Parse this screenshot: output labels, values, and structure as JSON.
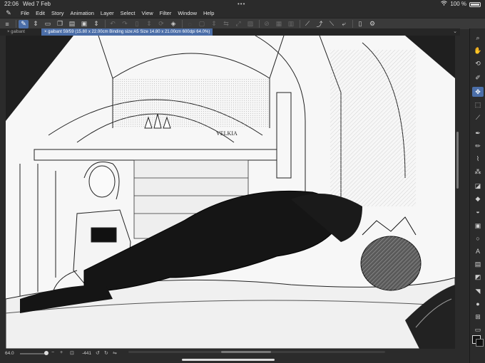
{
  "status": {
    "time": "22:06",
    "date": "Wed 7 Feb",
    "battery": "100 %"
  },
  "menu": [
    "File",
    "Edit",
    "Story",
    "Animation",
    "Layer",
    "Select",
    "View",
    "Filter",
    "Window",
    "Help"
  ],
  "tabs": {
    "first": "gaibant",
    "active": "gaibant 59/59 (15.80 x 22.00cm Binding size:A5 Size 14.80 x 21.00cm 600dpi 64.0%)"
  },
  "canvas": {
    "watermark": "VELKIA",
    "description_text": ""
  },
  "bottom": {
    "zoom": "64.0",
    "rotation": "-441"
  },
  "colors": {
    "accent": "#4b6ea8",
    "panel": "#2b2b2b",
    "toolbar": "#3a3a3a"
  }
}
